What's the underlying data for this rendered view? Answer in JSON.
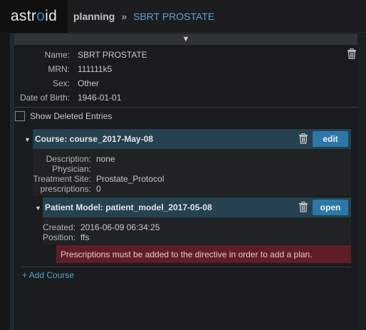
{
  "app": {
    "logo_prefix": "astr",
    "logo_accent": "o",
    "logo_suffix": "id"
  },
  "breadcrumb": {
    "section": "planning",
    "separator": "»",
    "current": "SBRT PROSTATE"
  },
  "collapse_toggle": "▼",
  "patient": {
    "name_label": "Name:",
    "name": "SBRT PROSTATE",
    "mrn_label": "MRN:",
    "mrn": "111111k5",
    "sex_label": "Sex:",
    "sex": "Other",
    "dob_label": "Date of Birth:",
    "dob": "1946-01-01"
  },
  "show_deleted": {
    "label": "Show Deleted Entries",
    "checked": false
  },
  "course": {
    "caret": "▼",
    "title": "Course: course_2017-May-08",
    "edit_label": "edit",
    "description_label": "Description:",
    "description": "none",
    "physician_label": "Physician:",
    "physician": "",
    "site_label": "Treatment Site:",
    "site": "Prostate_Protocol",
    "prescriptions_label": "prescriptions:",
    "prescriptions": "0"
  },
  "patient_model": {
    "caret": "▼",
    "title": "Patient Model: patient_model_2017-05-08",
    "open_label": "open",
    "created_label": "Created:",
    "created": "2016-06-09 06:34:25",
    "position_label": "Position:",
    "position": "ffs"
  },
  "alert": {
    "message": "Prescriptions must be added to the directive in order to add a plan."
  },
  "add_course_label": "+ Add Course",
  "colors": {
    "accent": "#2b78a8",
    "link": "#5aa3d6",
    "header_band": "#26414f",
    "alert_bg": "#5f1e27"
  },
  "icons": {
    "trash": "trash-icon",
    "caret": "caret-down-icon"
  }
}
